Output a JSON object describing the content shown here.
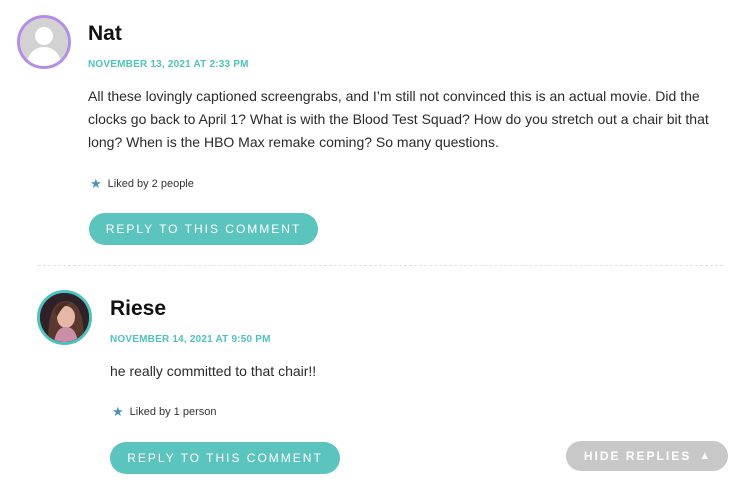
{
  "comments": [
    {
      "author": "Nat",
      "date": "NOVEMBER 13, 2021 AT 2:33 PM",
      "text": "All these lovingly captioned screengrabs, and I’m still not convinced this is an actual movie. Did the clocks go back to April 1? What is with the Blood Test Squad? How do you stretch out a chair bit that long? When is the HBO Max remake coming? So many questions.",
      "likes": "Liked by 2 people",
      "reply_label": "REPLY TO THIS COMMENT",
      "avatar_ring_color": "#b48ee6"
    },
    {
      "author": "Riese",
      "date": "NOVEMBER 14, 2021 AT 9:50 PM",
      "text": "he really committed to that chair!!",
      "likes": "Liked by 1 person",
      "reply_label": "REPLY TO THIS COMMENT",
      "avatar_ring_color": "#4ec2bd"
    }
  ],
  "hide_replies": {
    "label": "HIDE REPLIES",
    "icon": "triangle-up-icon"
  },
  "colors": {
    "accent": "#5cc4be",
    "date": "#4ec2bd",
    "star": "#4a90c2",
    "hide_button": "#c8c8c8"
  }
}
